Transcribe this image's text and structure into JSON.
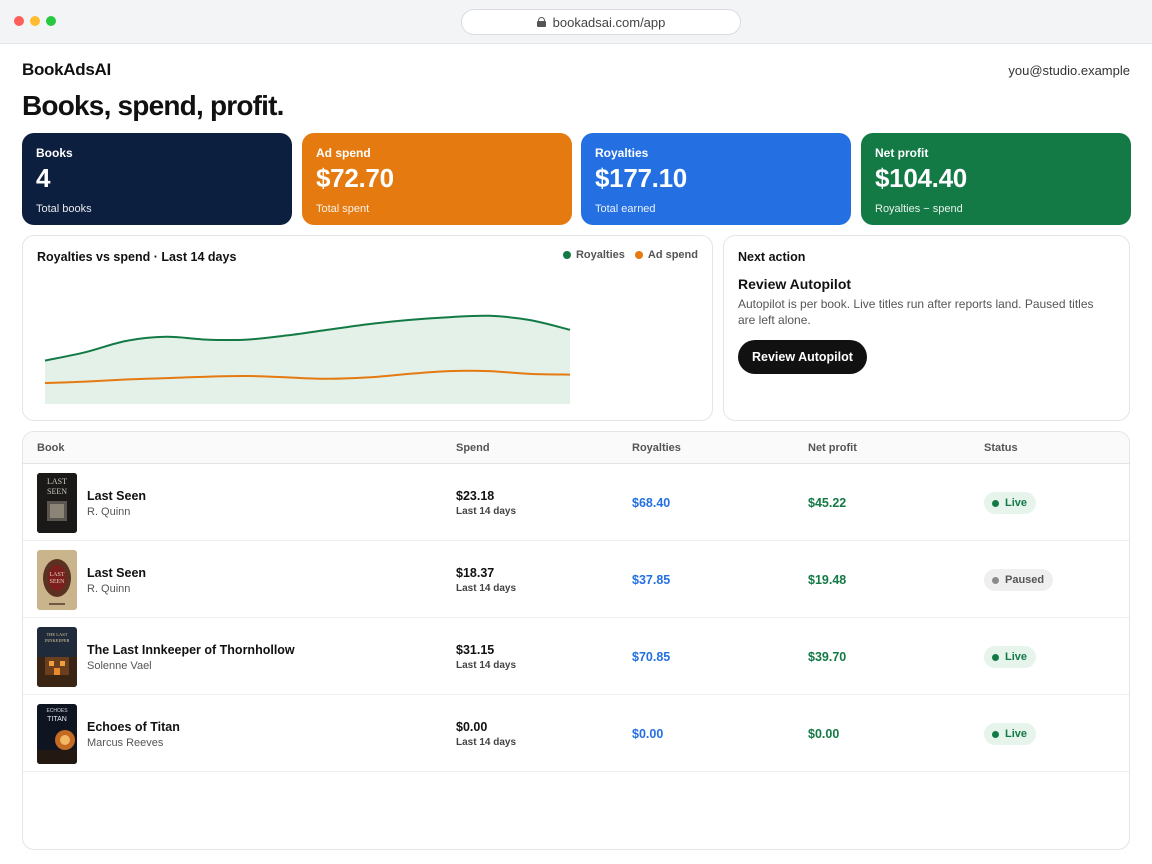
{
  "browser": {
    "url": "bookadsai.com/app"
  },
  "header": {
    "brand": "BookAdsAI",
    "account": "you@studio.example",
    "headline": "Books, spend, profit."
  },
  "stats": [
    {
      "label": "Books",
      "value": "4",
      "sub": "Total books",
      "color": "#0c1f3f"
    },
    {
      "label": "Ad spend",
      "value": "$72.70",
      "sub": "Total spent",
      "color": "#e57a10"
    },
    {
      "label": "Royalties",
      "value": "$177.10",
      "sub": "Total earned",
      "color": "#2470e3"
    },
    {
      "label": "Net profit",
      "value": "$104.40",
      "sub": "Royalties − spend",
      "color": "#137a45"
    }
  ],
  "chart_data": {
    "type": "area",
    "title": "Royalties vs spend · Last 14 days",
    "legend_position": "top-right",
    "grid": false,
    "ylim": [
      0,
      14
    ],
    "x": [
      1,
      2,
      3,
      4,
      5,
      6,
      7,
      8,
      9,
      10,
      11,
      12,
      13,
      14
    ],
    "series": [
      {
        "name": "Royalties",
        "color": "#137a45",
        "fill": "#e3f1e8",
        "values": [
          6.2,
          7.4,
          9.0,
          9.6,
          9.2,
          9.2,
          9.8,
          10.6,
          11.4,
          12.0,
          12.4,
          12.6,
          12.0,
          10.6
        ]
      },
      {
        "name": "Ad spend",
        "color": "#e57a10",
        "values": [
          3.0,
          3.2,
          3.5,
          3.7,
          3.9,
          4.0,
          3.8,
          3.6,
          3.8,
          4.3,
          4.7,
          4.7,
          4.3,
          4.2
        ]
      }
    ]
  },
  "next_action": {
    "kicker": "Next action",
    "title": "Review Autopilot",
    "description": "Autopilot is per book. Live titles run after reports land. Paused titles are left alone.",
    "button_label": "Review Autopilot"
  },
  "table": {
    "headers": {
      "book": "Book",
      "spend": "Spend",
      "royalties": "Royalties",
      "net_profit": "Net profit",
      "status": "Status"
    },
    "rows": [
      {
        "title": "Last Seen",
        "author": "R. Quinn",
        "spend": "$23.18",
        "spend_period": "Last 14 days",
        "royalties": "$68.40",
        "net_profit": "$45.22",
        "status": "Live",
        "cover_text": "LAST SEEN"
      },
      {
        "title": "Last Seen",
        "author": "R. Quinn",
        "spend": "$18.37",
        "spend_period": "Last 14 days",
        "royalties": "$37.85",
        "net_profit": "$19.48",
        "status": "Paused",
        "cover_text": "LAST SEEN"
      },
      {
        "title": "The Last Innkeeper of Thornhollow",
        "author": "Solenne Vael",
        "spend": "$31.15",
        "spend_period": "Last 14 days",
        "royalties": "$70.85",
        "net_profit": "$39.70",
        "status": "Live",
        "cover_text": "THE LAST INNKEEPER"
      },
      {
        "title": "Echoes of Titan",
        "author": "Marcus Reeves",
        "spend": "$0.00",
        "spend_period": "Last 14 days",
        "royalties": "$0.00",
        "net_profit": "$0.00",
        "status": "Live",
        "cover_text": "ECHOES TITAN"
      }
    ]
  }
}
